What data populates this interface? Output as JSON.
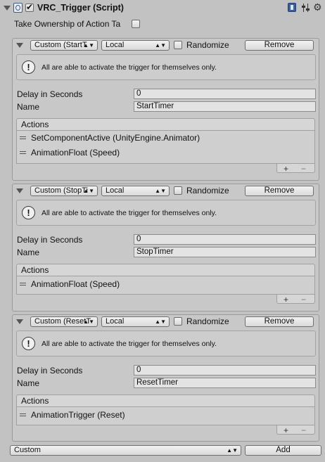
{
  "component": {
    "title": "VRC_Trigger (Script)",
    "ownership_label": "Take Ownership of Action Ta"
  },
  "triggers": [
    {
      "type": "Custom (StartT",
      "broadcast": "Local",
      "randomize_label": "Randomize",
      "remove_label": "Remove",
      "help_text": "All are able to activate the trigger for themselves only.",
      "delay_label": "Delay in Seconds",
      "delay_value": "0",
      "name_label": "Name",
      "name_value": "StartTimer",
      "actions_label": "Actions",
      "actions": [
        "SetComponentActive (UnityEngine.Animator)",
        "AnimationFloat (Speed)"
      ]
    },
    {
      "type": "Custom (StopTi",
      "broadcast": "Local",
      "randomize_label": "Randomize",
      "remove_label": "Remove",
      "help_text": "All are able to activate the trigger for themselves only.",
      "delay_label": "Delay in Seconds",
      "delay_value": "0",
      "name_label": "Name",
      "name_value": "StopTimer",
      "actions_label": "Actions",
      "actions": [
        "AnimationFloat (Speed)"
      ]
    },
    {
      "type": "Custom (ResetT",
      "broadcast": "Local",
      "randomize_label": "Randomize",
      "remove_label": "Remove",
      "help_text": "All are able to activate the trigger for themselves only.",
      "delay_label": "Delay in Seconds",
      "delay_value": "0",
      "name_label": "Name",
      "name_value": "ResetTimer",
      "actions_label": "Actions",
      "actions": [
        "AnimationTrigger (Reset)"
      ]
    }
  ],
  "footer": {
    "new_type": "Custom",
    "add_label": "Add"
  },
  "list_controls": {
    "add": "+",
    "remove": "−"
  },
  "icons": {
    "script": "script-icon",
    "help": "book-help-icon",
    "settings": "sliders-icon",
    "gear": "gear-icon",
    "info": "info-icon",
    "dropdown": "dropdown-arrow-icon"
  }
}
